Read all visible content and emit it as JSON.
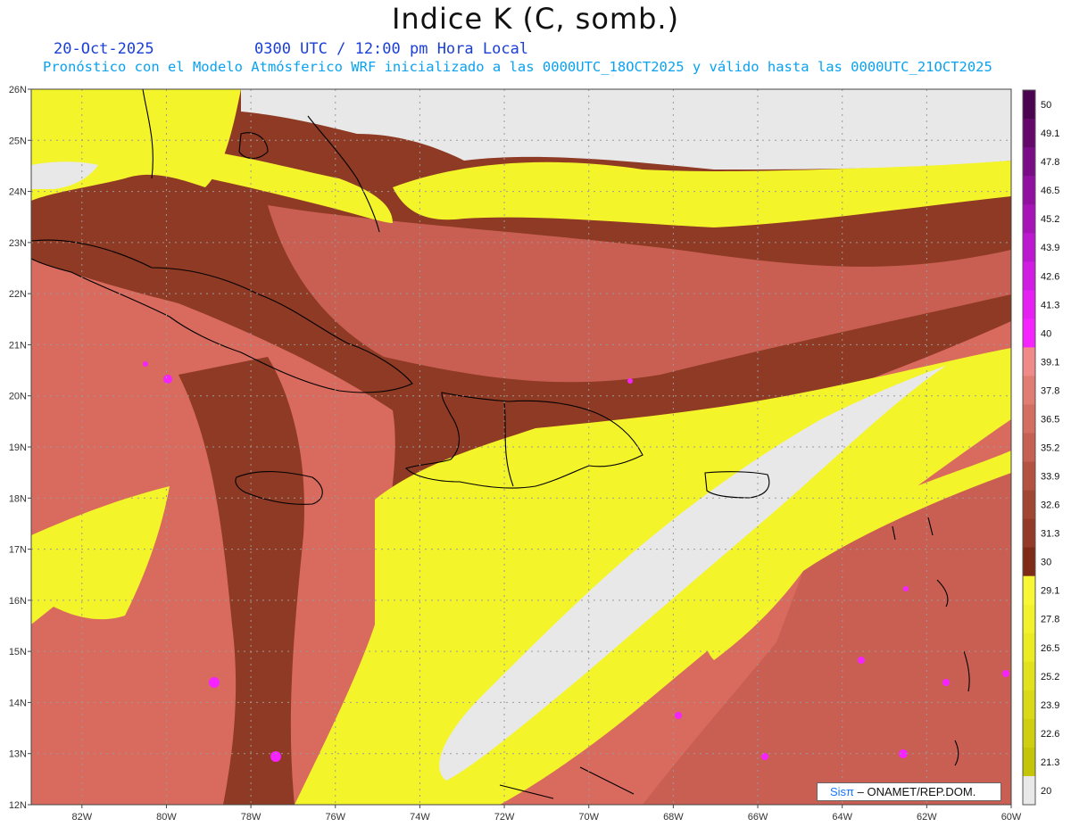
{
  "header": {
    "title": "Indice K (C, somb.)",
    "date": "20-Oct-2025",
    "time": "0300 UTC / 12:00 pm Hora Local",
    "description": "Pronóstico con el Modelo Atmósferico WRF inicializado a las 0000UTC_18OCT2025 y válido hasta las  0000UTC_21OCT2025"
  },
  "map": {
    "lon_range": [
      -83.2,
      -60
    ],
    "lat_range": [
      12,
      26
    ],
    "lon_ticks": [
      "82W",
      "80W",
      "78W",
      "76W",
      "74W",
      "72W",
      "70W",
      "68W",
      "66W",
      "64W",
      "62W",
      "60W"
    ],
    "lat_ticks": [
      "12N",
      "13N",
      "14N",
      "15N",
      "16N",
      "17N",
      "18N",
      "19N",
      "20N",
      "21N",
      "22N",
      "23N",
      "24N",
      "25N",
      "26N"
    ],
    "grid": true,
    "colors": {
      "no_data": "#e8e8e8",
      "low_yellow": "#f4f42a",
      "mid_brown": "#8e3a24",
      "high_salmon": "#d86a5e",
      "coastline": "#000000"
    }
  },
  "colorbar": {
    "labels": [
      "50",
      "49.1",
      "47.8",
      "46.5",
      "45.2",
      "43.9",
      "42.6",
      "41.3",
      "40",
      "39.1",
      "37.8",
      "36.5",
      "35.2",
      "33.9",
      "32.6",
      "31.3",
      "30",
      "29.1",
      "27.8",
      "26.5",
      "25.2",
      "23.9",
      "22.6",
      "21.3",
      "20"
    ],
    "colors": [
      "#4b0550",
      "#65086c",
      "#7a0c86",
      "#9110a0",
      "#a614b8",
      "#bb18cf",
      "#d01ce3",
      "#e520f2",
      "#f423ff",
      "#f08a88",
      "#e07c72",
      "#d46e62",
      "#c66052",
      "#b45241",
      "#a24634",
      "#933a28",
      "#7e2c18",
      "#f7f736",
      "#f1f12c",
      "#ebeb22",
      "#e2e21c",
      "#d9d916",
      "#cfcf10",
      "#c4c408",
      "#e8e8e8"
    ]
  },
  "credit": {
    "brand": "Sisπ",
    "text": " – ONAMET/REP.DOM."
  }
}
